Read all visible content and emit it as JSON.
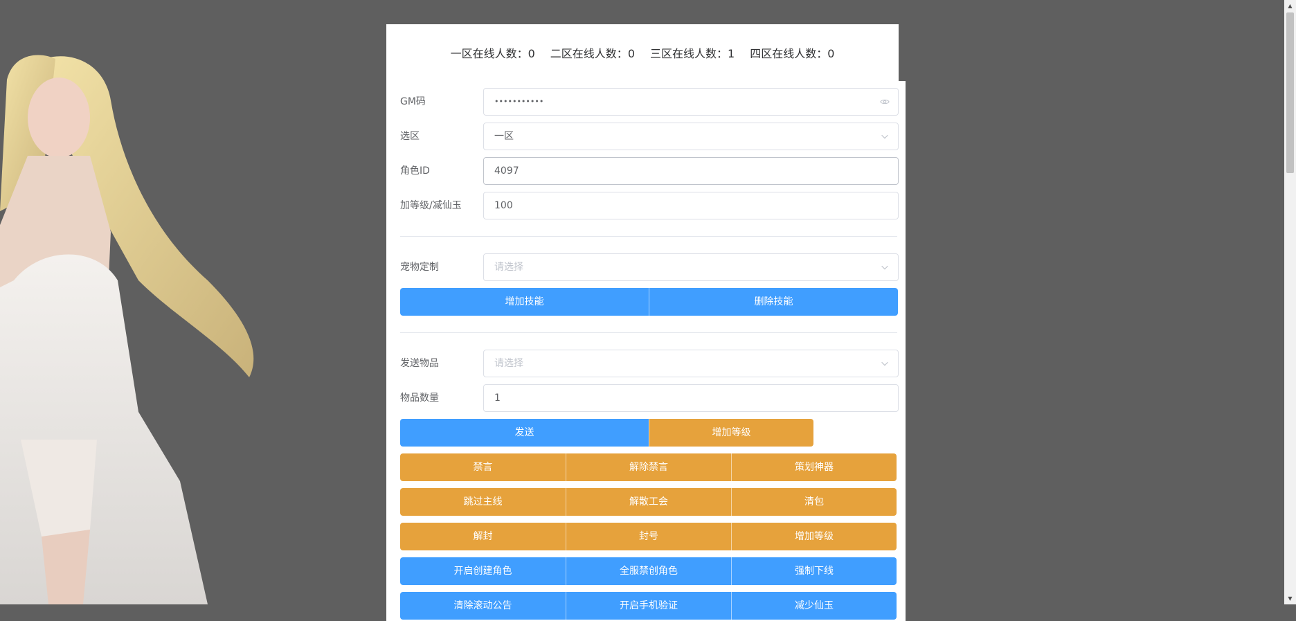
{
  "online": [
    {
      "label": "一区在线人数：",
      "count": "0"
    },
    {
      "label": "二区在线人数：",
      "count": "0"
    },
    {
      "label": "三区在线人数：",
      "count": "1"
    },
    {
      "label": "四区在线人数：",
      "count": "0"
    }
  ],
  "form": {
    "gm_code": {
      "label": "GM码",
      "value": "•••••••••••",
      "icon": "eye-icon"
    },
    "zone": {
      "label": "选区",
      "value": "一区",
      "icon": "chevron-down-icon"
    },
    "role_id": {
      "label": "角色ID",
      "value": "4097"
    },
    "level_amount": {
      "label": "加等级/减仙玉",
      "value": "100"
    },
    "pet": {
      "label": "宠物定制",
      "placeholder": "请选择",
      "icon": "chevron-down-icon"
    },
    "send_item": {
      "label": "发送物品",
      "placeholder": "请选择",
      "icon": "chevron-down-icon"
    },
    "item_qty": {
      "label": "物品数量",
      "value": "1"
    }
  },
  "buttons": {
    "add_skill": "增加技能",
    "delete_skill": "删除技能",
    "send": "发送",
    "add_level_1": "增加等级",
    "mute": "禁言",
    "unmute": "解除禁言",
    "planner_artifact": "策划神器",
    "skip_main_quest": "跳过主线",
    "disband_guild": "解散工会",
    "clear_bag": "清包",
    "unban": "解封",
    "ban_account": "封号",
    "add_level_2": "增加等级",
    "enable_create_role": "开启创建角色",
    "global_ban_create_role": "全服禁创角色",
    "force_offline": "强制下线",
    "clear_scroll_notice": "清除滚动公告",
    "enable_phone_verify": "开启手机验证",
    "reduce_jade": "减少仙玉"
  },
  "colors": {
    "primary": "#409eff",
    "warning": "#e6a23c",
    "background": "#5f5f5f"
  }
}
